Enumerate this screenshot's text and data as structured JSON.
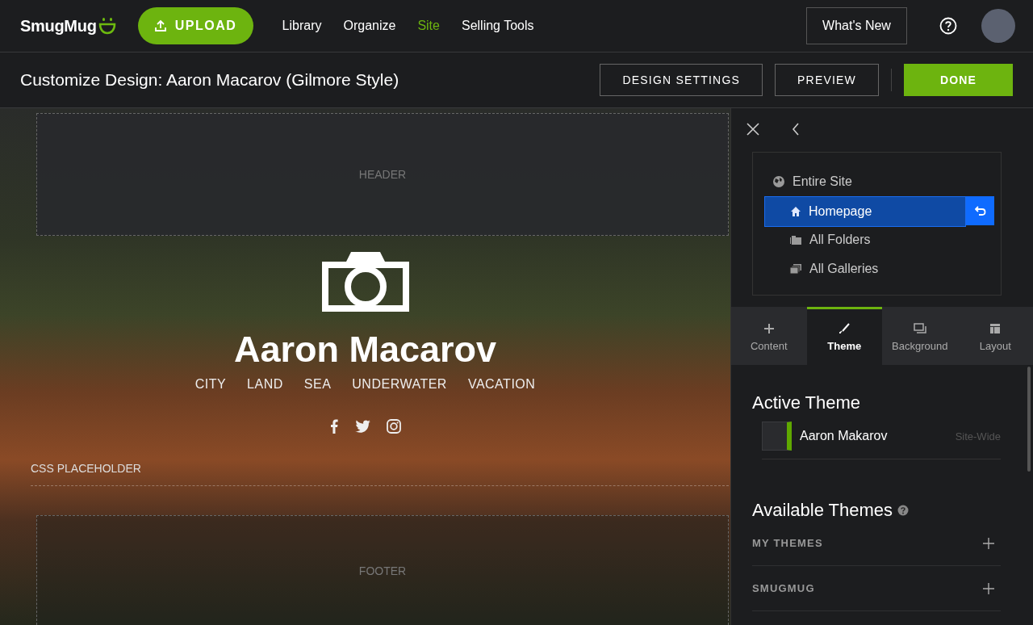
{
  "top_nav": {
    "logo": "SmugMug",
    "upload": "UPLOAD",
    "links": [
      {
        "label": "Library",
        "selected": false
      },
      {
        "label": "Organize",
        "selected": false
      },
      {
        "label": "Site",
        "selected": true
      },
      {
        "label": "Selling Tools",
        "selected": false
      }
    ],
    "whats_new": "What's New"
  },
  "toolbar": {
    "title": "Customize Design: Aaron Macarov (Gilmore Style)",
    "buttons": [
      {
        "label": "DESIGN SETTINGS",
        "kind": "outline"
      },
      {
        "label": "PREVIEW",
        "kind": "outline"
      },
      {
        "label": "DONE",
        "kind": "primary"
      }
    ]
  },
  "preview": {
    "header_label": "HEADER",
    "site_name": "Aaron Macarov",
    "menu": [
      "CITY",
      "LAND",
      "SEA",
      "UNDERWATER",
      "VACATION"
    ],
    "css_placeholder": "CSS PLACEHOLDER",
    "footer_label": "FOOTER"
  },
  "panel": {
    "scopes": [
      {
        "label": "Entire Site",
        "kind": "globe",
        "selected": false,
        "children": [
          {
            "label": "Homepage",
            "kind": "home",
            "selected": true
          },
          {
            "label": "All Folders",
            "kind": "folders",
            "selected": false
          },
          {
            "label": "All Galleries",
            "kind": "galleries",
            "selected": false
          }
        ]
      }
    ],
    "tabs": [
      {
        "label": "Content",
        "kind": "plus",
        "selected": false
      },
      {
        "label": "Theme",
        "kind": "brush",
        "selected": true
      },
      {
        "label": "Background",
        "kind": "background",
        "selected": false
      },
      {
        "label": "Layout",
        "kind": "layout",
        "selected": false
      }
    ],
    "active_theme": {
      "heading": "Active Theme",
      "name": "Aaron Makarov",
      "scope": "Site-Wide"
    },
    "available_themes": {
      "heading": "Available Themes",
      "groups": [
        "MY THEMES",
        "SMUGMUG"
      ]
    }
  }
}
